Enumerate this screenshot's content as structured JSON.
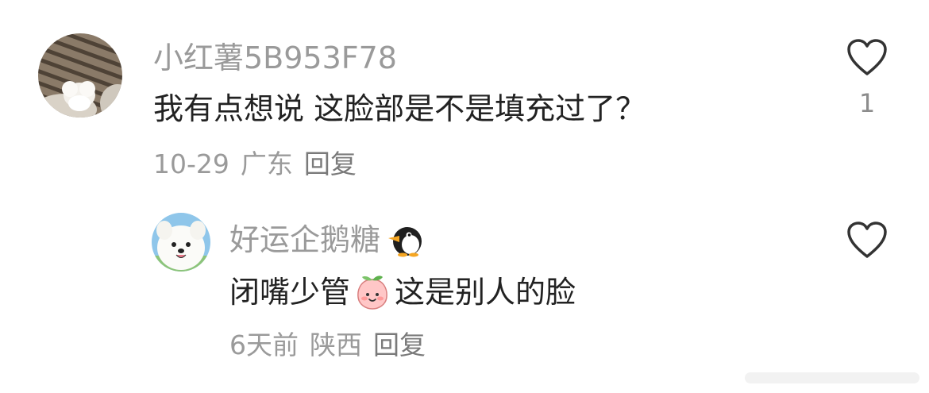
{
  "comments": [
    {
      "username": "小红薯5B953F78",
      "text": "我有点想说 这脸部是不是填充过了？",
      "date": "10-29",
      "location": "广东",
      "reply_label": "回复",
      "likes": "1",
      "avatar": "cat-paw-avatar"
    },
    {
      "username": "好运企鹅糖",
      "username_emoji": "penguin-icon",
      "text_before": "闭嘴少管",
      "text_emoji": "peach-face-emoji",
      "text_after": "这是别人的脸",
      "date": "6天前",
      "location": "陕西",
      "reply_label": "回复",
      "likes": "",
      "avatar": "samoyed-dog-avatar"
    }
  ],
  "colors": {
    "username": "#9a9a9a",
    "text": "#222222",
    "meta": "#9a9a9a",
    "heart_outline": "#333333"
  }
}
